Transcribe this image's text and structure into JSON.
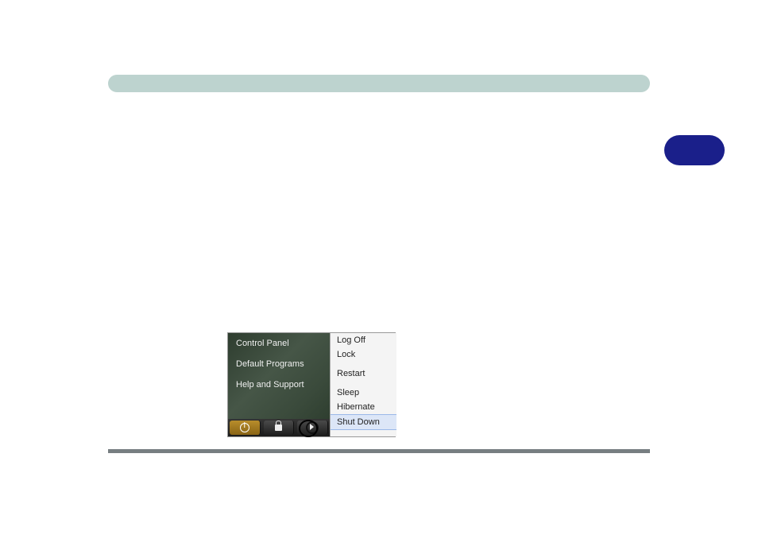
{
  "figure": {
    "left_items": [
      "Control Panel",
      "Default Programs",
      "Help and Support"
    ],
    "right_items": [
      "Log Off",
      "Lock",
      "Restart",
      "Sleep",
      "Hibernate",
      "Shut Down"
    ],
    "highlight_index": 5,
    "icons": {
      "power": "power-icon",
      "lock": "lock-icon",
      "arrow": "arrow-right-icon"
    }
  }
}
